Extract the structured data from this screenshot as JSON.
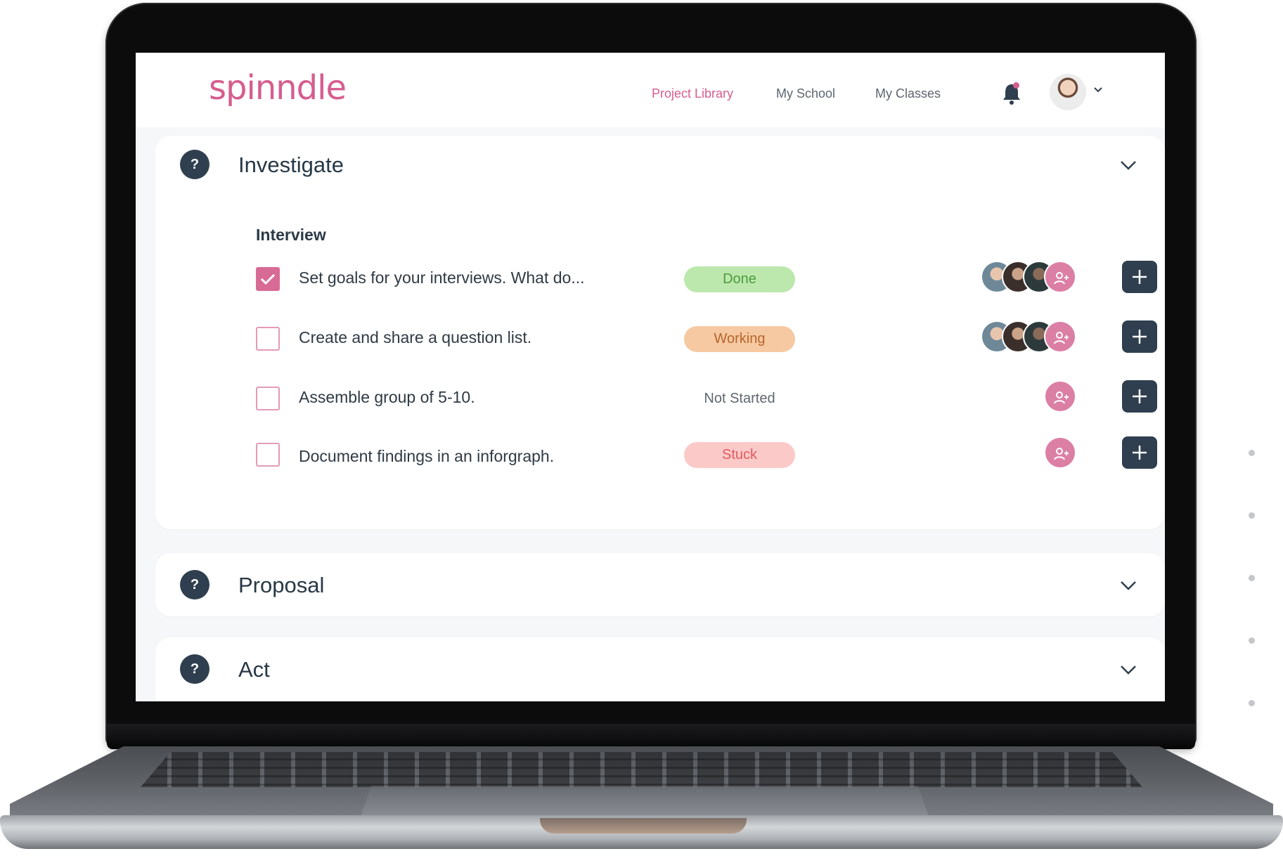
{
  "app": {
    "logo": "spinndle",
    "nav": [
      {
        "label": "Project Library",
        "active": true
      },
      {
        "label": "My School",
        "active": false
      },
      {
        "label": "My Classes",
        "active": false
      }
    ],
    "notification_icon": "bell-icon",
    "profile_icon": "avatar"
  },
  "sections": [
    {
      "title": "Investigate",
      "icon": "?",
      "expanded": true,
      "subheading": "Interview",
      "tasks": [
        {
          "text": "Set goals for your interviews. What do...",
          "checked": true,
          "status": "Done",
          "assignees": 3
        },
        {
          "text": "Create and share a question list.",
          "checked": false,
          "status": "Working",
          "assignees": 3
        },
        {
          "text": "Assemble group of 5-10.",
          "checked": false,
          "status": "Not Started",
          "assignees": 0
        },
        {
          "text": "Document findings in an inforgraph.",
          "checked": false,
          "status": "Stuck",
          "assignees": 0
        }
      ]
    },
    {
      "title": "Proposal",
      "icon": "?",
      "expanded": false
    },
    {
      "title": "Act",
      "icon": "?",
      "expanded": false
    }
  ],
  "colors": {
    "brand_pink": "#d65d8f",
    "dark_navy": "#2f3f4f",
    "done": "#bde8ad",
    "working": "#f6c9a2",
    "stuck": "#fcc9c9"
  }
}
